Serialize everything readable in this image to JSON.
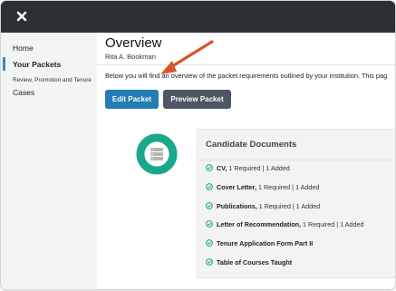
{
  "window": {
    "close_icon": "close-x-icon"
  },
  "sidebar": {
    "items": [
      {
        "label": "Home"
      },
      {
        "label": "Your Packets"
      },
      {
        "label": "Review, Promotion and Tenure"
      },
      {
        "label": "Cases"
      }
    ]
  },
  "page": {
    "title": "Overview",
    "subtitle": "Rita A. Bookman",
    "intro": "Below you will find an overview of the packet requirements outlined by your institution. This pag"
  },
  "actions": {
    "edit_label": "Edit Packet",
    "preview_label": "Preview Packet"
  },
  "documents": {
    "title": "Candidate Documents",
    "items": [
      {
        "name": "CV,",
        "detail": " 1 Required | 1 Added"
      },
      {
        "name": "Cover Letter,",
        "detail": " 1 Required | 1 Added"
      },
      {
        "name": "Publications,",
        "detail": " 1 Required | 1 Added"
      },
      {
        "name": "Letter of Recommendation,",
        "detail": " 1 Required | 1 Added"
      },
      {
        "name": "Tenure Application Form Part II",
        "detail": ""
      },
      {
        "name": "Table of Courses Taught",
        "detail": ""
      }
    ]
  },
  "colors": {
    "accent_teal": "#1aa88c",
    "primary_blue": "#237cb2",
    "annotation_arrow": "#d9532c"
  }
}
